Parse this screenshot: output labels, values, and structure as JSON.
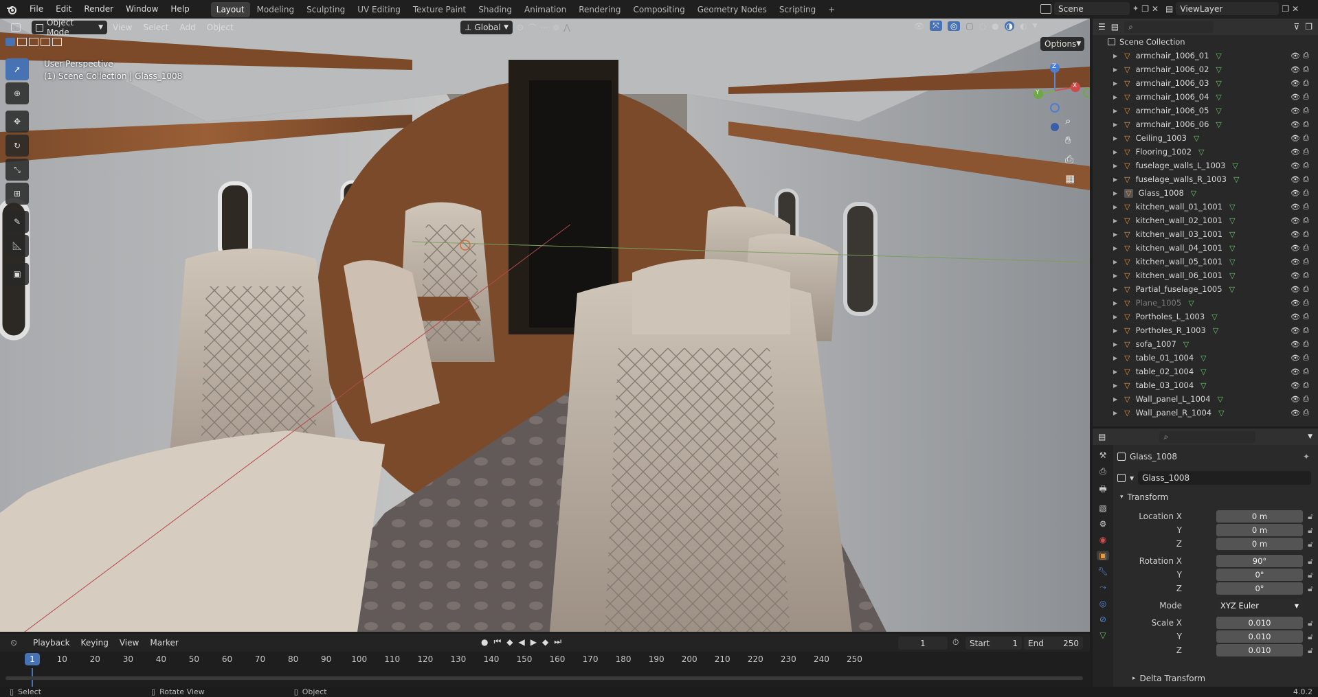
{
  "menu": {
    "items": [
      "File",
      "Edit",
      "Render",
      "Window",
      "Help"
    ],
    "workspaces": [
      "Layout",
      "Modeling",
      "Sculpting",
      "UV Editing",
      "Texture Paint",
      "Shading",
      "Animation",
      "Rendering",
      "Compositing",
      "Geometry Nodes",
      "Scripting"
    ],
    "active_workspace": "Layout",
    "add_tab": "+",
    "scene": "Scene",
    "view_layer": "ViewLayer"
  },
  "viewport": {
    "mode": "Object Mode",
    "menus": [
      "View",
      "Select",
      "Add",
      "Object"
    ],
    "orientation": "Global",
    "options": "Options",
    "info_line1": "User Perspective",
    "info_line2": "(1) Scene Collection | Glass_1008",
    "gizmo_x": "X",
    "gizmo_y": "Y",
    "gizmo_z": "Z"
  },
  "outliner": {
    "root": "Scene Collection",
    "items": [
      {
        "name": "armchair_1006_01",
        "dim": false,
        "selected": false
      },
      {
        "name": "armchair_1006_02",
        "dim": false,
        "selected": false
      },
      {
        "name": "armchair_1006_03",
        "dim": false,
        "selected": false
      },
      {
        "name": "armchair_1006_04",
        "dim": false,
        "selected": false
      },
      {
        "name": "armchair_1006_05",
        "dim": false,
        "selected": false
      },
      {
        "name": "armchair_1006_06",
        "dim": false,
        "selected": false
      },
      {
        "name": "Ceiling_1003",
        "dim": false,
        "selected": false
      },
      {
        "name": "Flooring_1002",
        "dim": false,
        "selected": false
      },
      {
        "name": "fuselage_walls_L_1003",
        "dim": false,
        "selected": false
      },
      {
        "name": "fuselage_walls_R_1003",
        "dim": false,
        "selected": false
      },
      {
        "name": "Glass_1008",
        "dim": false,
        "selected": true
      },
      {
        "name": "kitchen_wall_01_1001",
        "dim": false,
        "selected": false
      },
      {
        "name": "kitchen_wall_02_1001",
        "dim": false,
        "selected": false
      },
      {
        "name": "kitchen_wall_03_1001",
        "dim": false,
        "selected": false
      },
      {
        "name": "kitchen_wall_04_1001",
        "dim": false,
        "selected": false
      },
      {
        "name": "kitchen_wall_05_1001",
        "dim": false,
        "selected": false
      },
      {
        "name": "kitchen_wall_06_1001",
        "dim": false,
        "selected": false
      },
      {
        "name": "Partial_fuselage_1005",
        "dim": false,
        "selected": false
      },
      {
        "name": "Plane_1005",
        "dim": true,
        "selected": false
      },
      {
        "name": "Portholes_L_1003",
        "dim": false,
        "selected": false
      },
      {
        "name": "Portholes_R_1003",
        "dim": false,
        "selected": false
      },
      {
        "name": "sofa_1007",
        "dim": false,
        "selected": false
      },
      {
        "name": "table_01_1004",
        "dim": false,
        "selected": false
      },
      {
        "name": "table_02_1004",
        "dim": false,
        "selected": false
      },
      {
        "name": "table_03_1004",
        "dim": false,
        "selected": false
      },
      {
        "name": "Wall_panel_L_1004",
        "dim": false,
        "selected": false
      },
      {
        "name": "Wall_panel_R_1004",
        "dim": false,
        "selected": false
      }
    ]
  },
  "properties": {
    "object_header": "Glass_1008",
    "object_name": "Glass_1008",
    "transform_label": "Transform",
    "location": {
      "label_x": "Location X",
      "x": "0 m",
      "y": "0 m",
      "z": "0 m"
    },
    "rotation": {
      "label_x": "Rotation X",
      "x": "90°",
      "y": "0°",
      "z": "0°"
    },
    "mode_label": "Mode",
    "mode_value": "XYZ Euler",
    "scale": {
      "label_x": "Scale X",
      "x": "0.010",
      "y": "0.010",
      "z": "0.010"
    },
    "axis_y": "Y",
    "axis_z": "Z",
    "delta_label": "Delta Transform"
  },
  "timeline": {
    "menus": [
      "Playback",
      "Keying",
      "View",
      "Marker"
    ],
    "current_frame": "1",
    "start_label": "Start",
    "start": "1",
    "end_label": "End",
    "end": "250",
    "ticks": [
      "10",
      "20",
      "30",
      "40",
      "50",
      "60",
      "70",
      "80",
      "90",
      "100",
      "110",
      "120",
      "130",
      "140",
      "150",
      "160",
      "170",
      "180",
      "190",
      "200",
      "210",
      "220",
      "230",
      "240",
      "250"
    ],
    "playhead": "1"
  },
  "status": {
    "select": "Select",
    "rotate": "Rotate View",
    "object": "Object",
    "version": "4.0.2"
  },
  "colors": {
    "accent": "#4772b3",
    "selected_row": "#334d80",
    "mesh_icon": "#e89a3c",
    "data_icon": "#6bc66b"
  }
}
